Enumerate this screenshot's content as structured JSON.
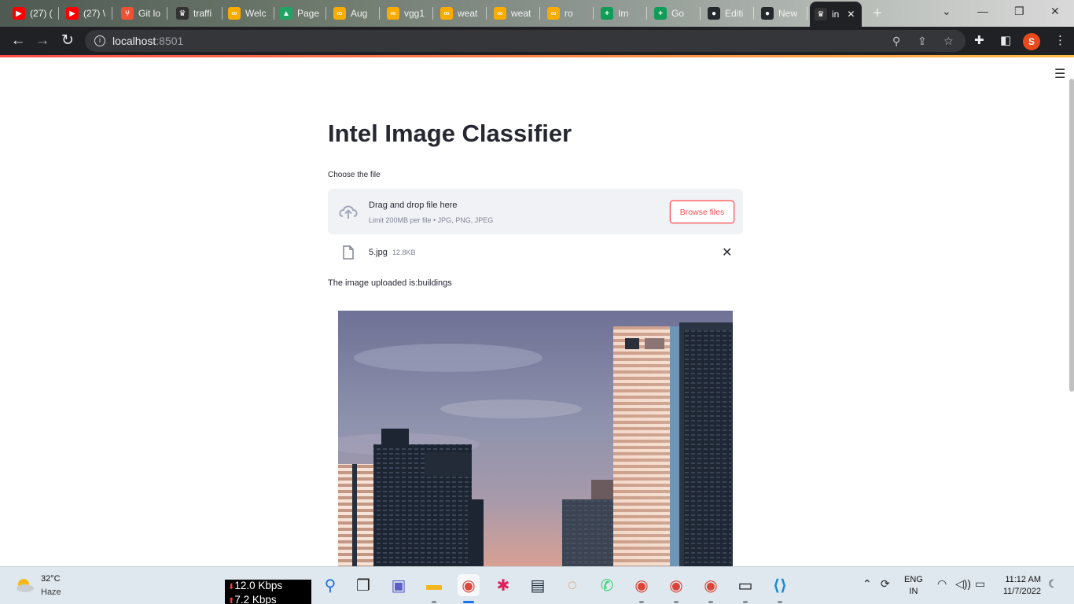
{
  "browser": {
    "tabs": [
      {
        "label": "(27) (",
        "favicon": "youtube-icon",
        "color": "#ff0000",
        "glyph": "▶"
      },
      {
        "label": "(27) \\",
        "favicon": "youtube-icon",
        "color": "#ff0000",
        "glyph": "▶"
      },
      {
        "label": "Git lo",
        "favicon": "git-icon",
        "color": "#f05033",
        "glyph": "⑂"
      },
      {
        "label": "traffi",
        "favicon": "streamlit-icon",
        "color": "#333333",
        "glyph": "♛"
      },
      {
        "label": "Welc",
        "favicon": "colab-icon",
        "color": "#f9ab00",
        "glyph": "∞"
      },
      {
        "label": "Page",
        "favicon": "drive-icon",
        "color": "#1fa463",
        "glyph": "▲"
      },
      {
        "label": "Aug",
        "favicon": "colab-icon",
        "color": "#f9ab00",
        "glyph": "∞"
      },
      {
        "label": "vgg1",
        "favicon": "colab-icon",
        "color": "#f9ab00",
        "glyph": "∞"
      },
      {
        "label": "weat",
        "favicon": "colab-icon",
        "color": "#f9ab00",
        "glyph": "∞"
      },
      {
        "label": "weat",
        "favicon": "colab-icon",
        "color": "#f9ab00",
        "glyph": "∞"
      },
      {
        "label": "ro",
        "favicon": "colab-icon",
        "color": "#f9ab00",
        "glyph": "∞"
      },
      {
        "label": "Im",
        "favicon": "sheets-icon",
        "color": "#0f9d58",
        "glyph": "+"
      },
      {
        "label": "Go",
        "favicon": "sheets-icon",
        "color": "#0f9d58",
        "glyph": "+"
      },
      {
        "label": "Editi",
        "favicon": "github-icon",
        "color": "#24292e",
        "glyph": "●"
      },
      {
        "label": "New",
        "favicon": "github-icon",
        "color": "#24292e",
        "glyph": "●"
      },
      {
        "label": "in",
        "favicon": "streamlit-icon",
        "color": "#333333",
        "glyph": "♛",
        "active": true
      }
    ],
    "url_host": "localhost",
    "url_port": ":8501",
    "profile_initial": "S"
  },
  "app": {
    "title": "Intel Image Classifier",
    "uploader_label": "Choose the file",
    "dropzone_title": "Drag and drop file here",
    "dropzone_subtitle": "Limit 200MB per file • JPG, PNG, JPEG",
    "browse_label": "Browse files",
    "file_name": "5.jpg",
    "file_size": "12.8KB",
    "result_text": "The image uploaded is:buildings",
    "accent_color": "#ff4b4b"
  },
  "taskbar": {
    "weather_temp": "32°C",
    "weather_desc": "Haze",
    "net_down": "12.0 Kbps",
    "net_up": "7.2 Kbps",
    "lang_1": "ENG",
    "lang_2": "IN",
    "time": "11:12 AM",
    "date": "11/7/2022",
    "apps": [
      {
        "name": "search-app-icon",
        "glyph": "⚲",
        "color": "#1e6fd9"
      },
      {
        "name": "task-view-icon",
        "glyph": "❐",
        "color": "#222222"
      },
      {
        "name": "teams-chat-icon",
        "glyph": "▣",
        "color": "#5b5fc7"
      },
      {
        "name": "file-explorer-icon",
        "glyph": "▬",
        "color": "#f2b61e"
      },
      {
        "name": "chrome-app-icon",
        "glyph": "◉",
        "color": "#db4437"
      },
      {
        "name": "slack-app-icon",
        "glyph": "✱",
        "color": "#e01e5a"
      },
      {
        "name": "mysql-app-icon",
        "glyph": "▤",
        "color": "#1f2c3a"
      },
      {
        "name": "jupyter-app-icon",
        "glyph": "◌",
        "color": "#f37626"
      },
      {
        "name": "whatsapp-app-icon",
        "glyph": "✆",
        "color": "#25d366"
      },
      {
        "name": "chrome-profile-2-icon",
        "glyph": "◉",
        "color": "#db4437"
      },
      {
        "name": "chrome-profile-3-icon",
        "glyph": "◉",
        "color": "#db4437"
      },
      {
        "name": "chrome-profile-4-icon",
        "glyph": "◉",
        "color": "#db4437"
      },
      {
        "name": "terminal-app-icon",
        "glyph": "▭",
        "color": "#111111"
      },
      {
        "name": "vscode-app-icon",
        "glyph": "⟨⟩",
        "color": "#1f8ad2"
      }
    ]
  }
}
